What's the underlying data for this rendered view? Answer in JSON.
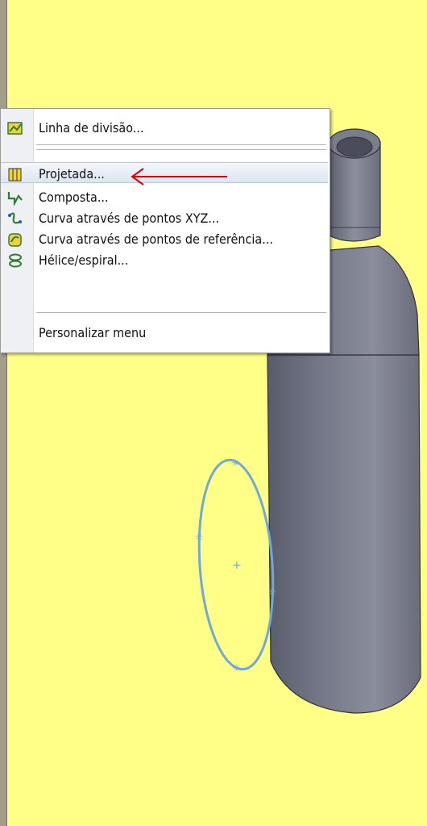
{
  "menu": {
    "items": [
      {
        "label": "Linha de divisão...",
        "icon": "split-line-icon"
      },
      {
        "label": "Projetada...",
        "icon": "projected-curve-icon",
        "highlighted": true
      },
      {
        "label": "Composta...",
        "icon": "composite-curve-icon"
      },
      {
        "label": "Curva através de pontos XYZ...",
        "icon": "curve-xyz-points-icon"
      },
      {
        "label": "Curva através de pontos de referência...",
        "icon": "curve-reference-points-icon"
      },
      {
        "label": "Hélice/espiral...",
        "icon": "helix-spiral-icon"
      }
    ],
    "customize_label": "Personalizar menu"
  },
  "colors": {
    "background": "#ffff88",
    "part_body": "#6f7282",
    "sketch": "#6fa8dc",
    "annotation_arrow": "#e00000",
    "highlight": "#dde5f0"
  }
}
